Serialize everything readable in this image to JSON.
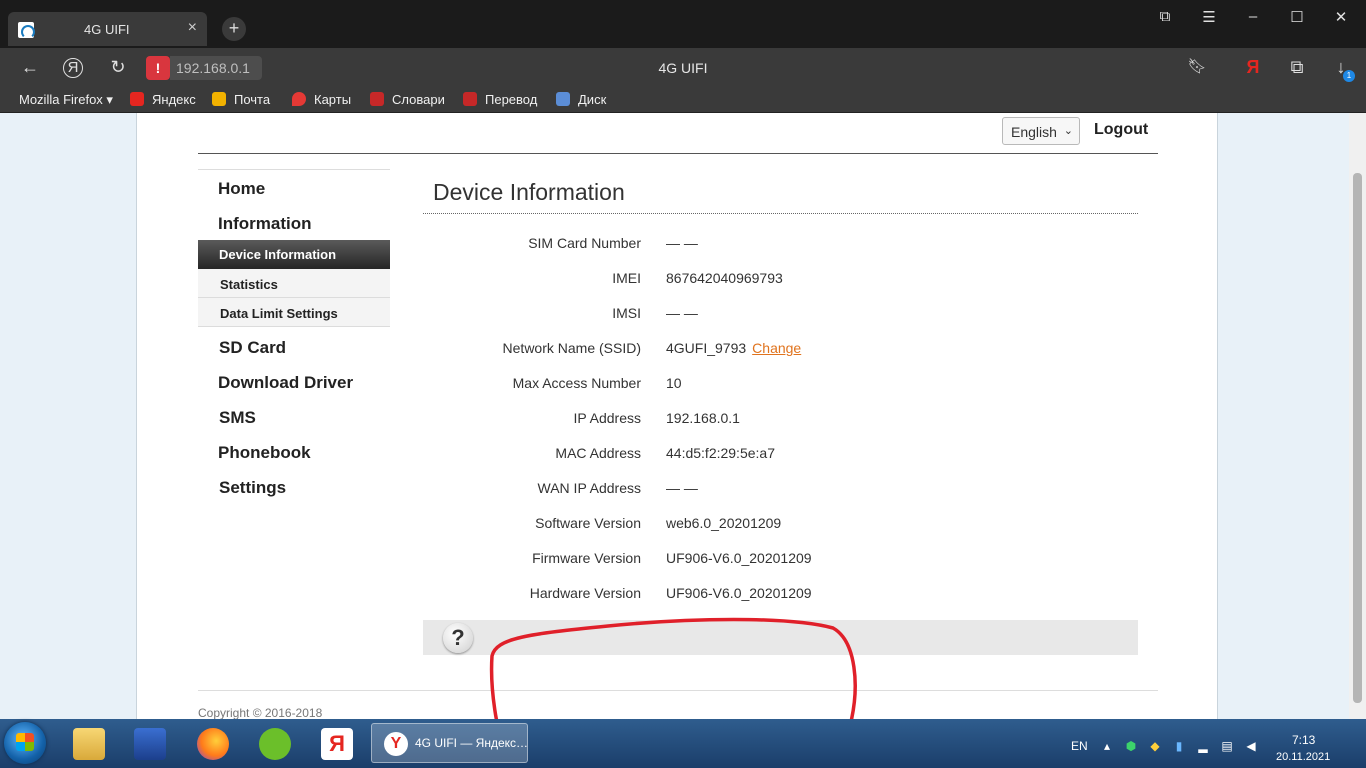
{
  "browser": {
    "tab_title": "4G UIFI",
    "tab_close": "×",
    "new_tab": "+",
    "url": "192.168.0.1",
    "page_title": "4G UIFI",
    "download_count": "1",
    "bookmarks": [
      {
        "label": "Mozilla Firefox ▾",
        "icon": "none"
      },
      {
        "label": "Яндекс",
        "icon": "yandex-icon",
        "color": "#e52620"
      },
      {
        "label": "Почта",
        "icon": "mail-icon",
        "color": "#f2b200"
      },
      {
        "label": "Карты",
        "icon": "maps-icon",
        "color": "#e53935"
      },
      {
        "label": "Словари",
        "icon": "dictionary-icon",
        "color": "#c62828"
      },
      {
        "label": "Перевод",
        "icon": "translate-icon",
        "color": "#c62828"
      },
      {
        "label": "Диск",
        "icon": "disk-icon",
        "color": "#5b8dd6"
      }
    ]
  },
  "header": {
    "language": "English",
    "logout": "Logout"
  },
  "menu": {
    "home": "Home",
    "information": "Information",
    "sub_active": "Device Information",
    "sub_statistics": "Statistics",
    "sub_data_limit": "Data Limit Settings",
    "sd_card": "SD Card",
    "download_driver": "Download Driver",
    "sms": "SMS",
    "phonebook": "Phonebook",
    "settings": "Settings"
  },
  "main": {
    "title": "Device Information",
    "rows": [
      {
        "label": "SIM Card Number",
        "value": "— —"
      },
      {
        "label": "IMEI",
        "value": "867642040969793"
      },
      {
        "label": "IMSI",
        "value": "— —"
      },
      {
        "label": "Network Name (SSID)",
        "value": "4GUFI_9793",
        "link": "Change"
      },
      {
        "label": "Max Access Number",
        "value": "10"
      },
      {
        "label": "IP Address",
        "value": "192.168.0.1"
      },
      {
        "label": "MAC Address",
        "value": "44:d5:f2:29:5e:a7"
      },
      {
        "label": "WAN IP Address",
        "value": "— —"
      },
      {
        "label": "Software Version",
        "value": "web6.0_20201209"
      },
      {
        "label": "Firmware Version",
        "value": "UF906-V6.0_20201209"
      },
      {
        "label": "Hardware Version",
        "value": "UF906-V6.0_20201209"
      }
    ],
    "help": "?"
  },
  "footer": {
    "copyright": "Copyright © 2016-2018"
  },
  "taskbar": {
    "active_window": "4G UIFI — Яндекс…",
    "lang": "EN",
    "time": "7:13",
    "date": "20.11.2021"
  },
  "colors": {
    "accent_link": "#e0731d",
    "annotation": "#e0202a",
    "active_menu": "#3a3a3a"
  }
}
